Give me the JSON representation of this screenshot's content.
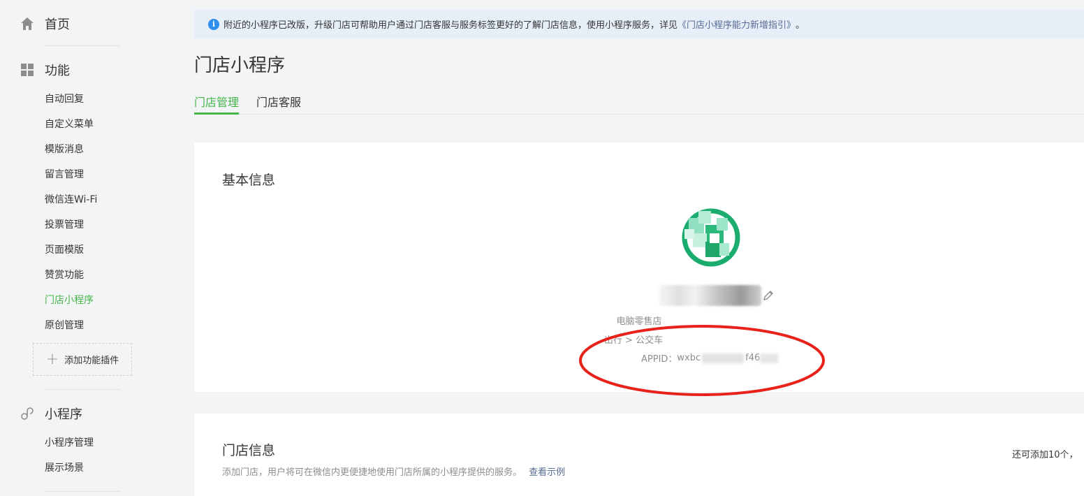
{
  "sidebar": {
    "home": "首页",
    "functions": "功能",
    "function_items": [
      "自动回复",
      "自定义菜单",
      "模版消息",
      "留言管理",
      "微信连Wi-Fi",
      "投票管理",
      "页面模版",
      "赞赏功能",
      "门店小程序",
      "原创管理"
    ],
    "active_item": "门店小程序",
    "add_plugin": "添加功能插件",
    "miniprogram": "小程序",
    "miniprogram_items": [
      "小程序管理",
      "展示场景"
    ]
  },
  "notice": {
    "text": "附近的小程序已改版，升级门店可帮助用户通过门店客服与服务标签更好的了解门店信息，使用小程序服务，详见",
    "link": "《门店小程序能力新增指引》",
    "end": "。"
  },
  "page": {
    "title": "门店小程序",
    "tabs": [
      "门店管理",
      "门店客服"
    ]
  },
  "basic_info": {
    "title": "基本信息",
    "category": "电脑零售店",
    "industry": "出行 > 公交车",
    "appid_label": "APPID：",
    "appid_prefix": "wxbc",
    "appid_middle": "f46"
  },
  "store_info": {
    "title": "门店信息",
    "description": "添加门店，用户将可在微信内更便捷地使用门店所属的小程序提供的服务。",
    "example_link": "查看示例",
    "remaining": "还可添加10个，"
  },
  "colors": {
    "accent": "#44b549",
    "link": "#576b95",
    "annotation": "#e8221b"
  }
}
